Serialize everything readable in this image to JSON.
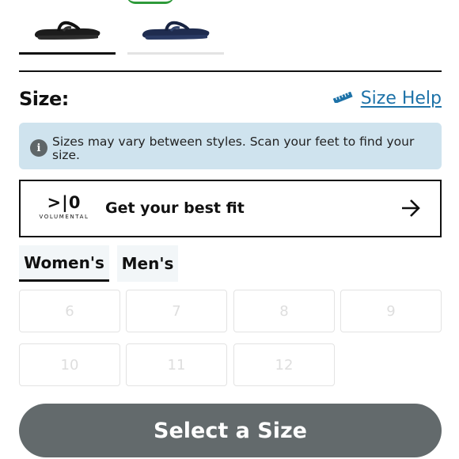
{
  "swatches": [
    {
      "color": "#1c1c1c",
      "selected": true
    },
    {
      "color": "#1f2c4f",
      "selected": false
    }
  ],
  "size_section": {
    "label": "Size:",
    "help_label": "Size Help",
    "help_icon": "ruler-icon"
  },
  "info_banner": {
    "icon": "info-icon",
    "icon_glyph": "i",
    "text": "Sizes may vary between styles. Scan your feet to find your size."
  },
  "fit_box": {
    "logo_mark": ">|0",
    "logo_word": "VOLUMENTAL",
    "text": "Get your best fit",
    "icon": "arrow-right-icon"
  },
  "tabs": [
    {
      "label": "Women's",
      "active": true
    },
    {
      "label": "Men's",
      "active": false
    }
  ],
  "sizes": [
    "6",
    "7",
    "8",
    "9",
    "10",
    "11",
    "12"
  ],
  "select_button": {
    "label": "Select a Size"
  },
  "colors": {
    "accent_link": "#1d72a8",
    "banner_bg": "#cfe3ee",
    "button_bg": "#636a6c"
  }
}
